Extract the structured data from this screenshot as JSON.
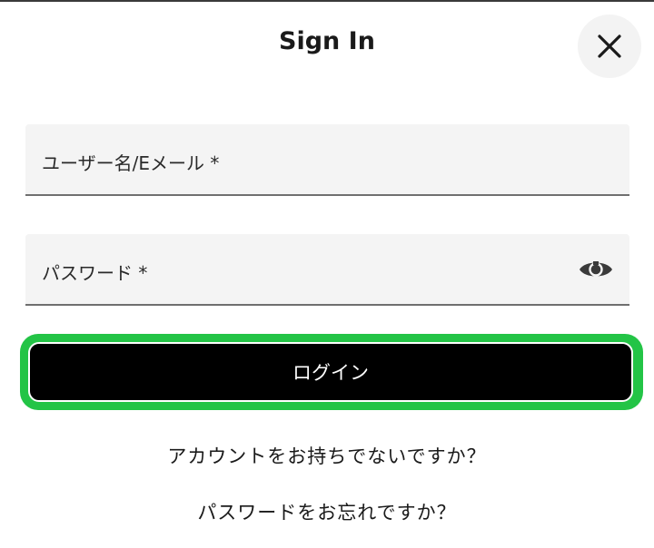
{
  "header": {
    "title": "Sign In",
    "close_icon": "close-icon"
  },
  "form": {
    "username_label": "ユーザー名/Eメール *",
    "password_label": "パスワード *",
    "password_toggle_icon": "eye-icon",
    "login_label": "ログイン"
  },
  "links": {
    "signup": "アカウントをお持ちでないですか？",
    "forgot_password": "パスワードをお忘れですか？"
  },
  "colors": {
    "focus_ring": "#23c446",
    "button_bg": "#000000",
    "field_bg": "#f4f4f4"
  }
}
